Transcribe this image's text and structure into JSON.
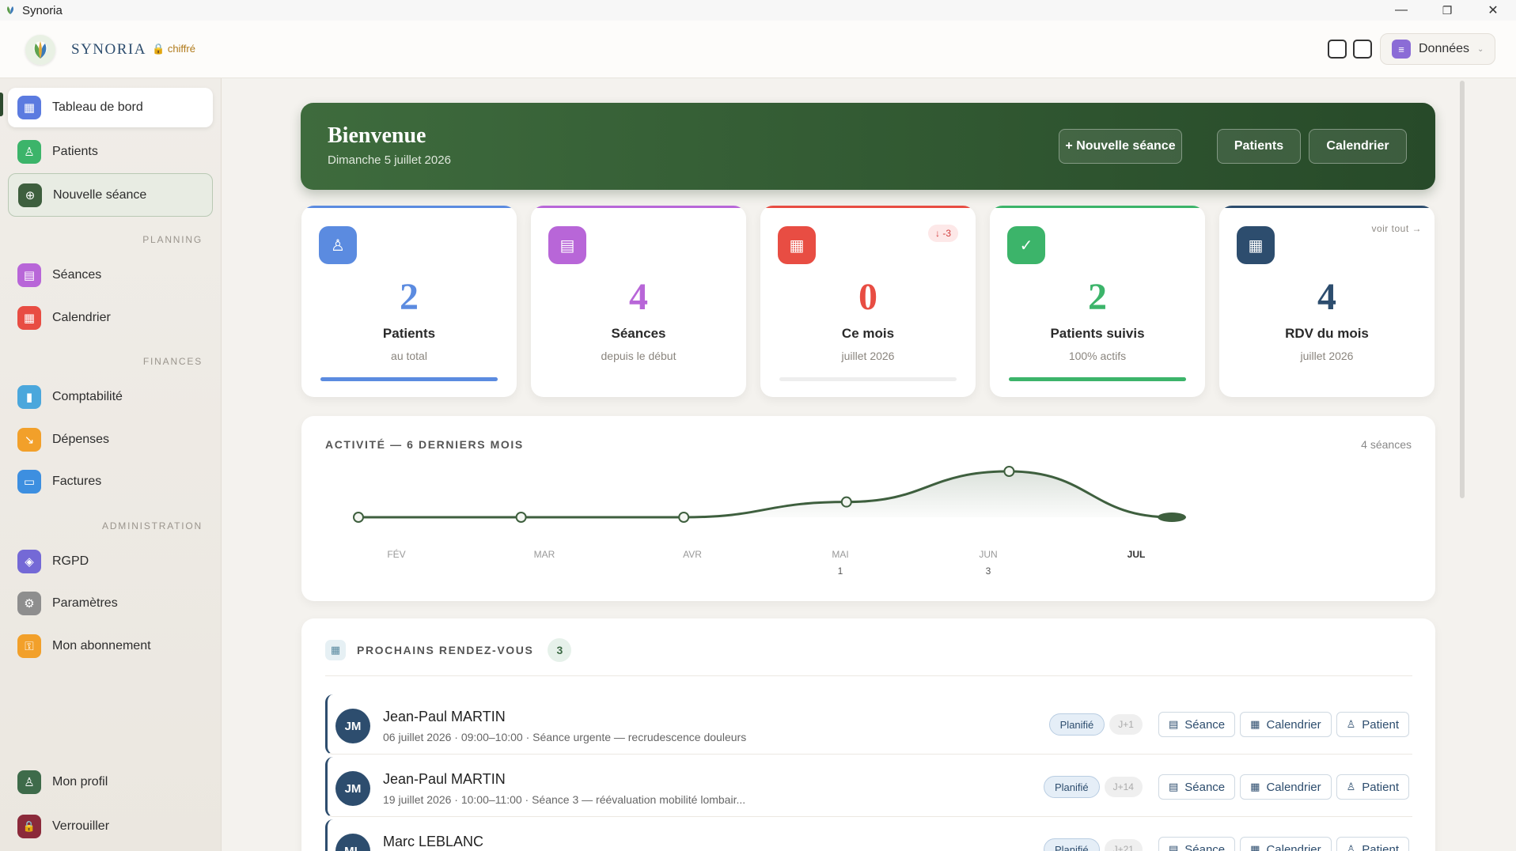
{
  "window": {
    "title": "Synoria",
    "controls": [
      "—",
      "❐",
      "✕"
    ]
  },
  "header": {
    "brand": "SYNORIA",
    "lock_badge": "chiffré",
    "data_button": "Données",
    "caret": "⌄"
  },
  "sidebar": {
    "top_items": [
      {
        "label": "Tableau de bord",
        "icon": "grid-icon",
        "glyph": "▦",
        "color": "#5b7be0"
      },
      {
        "label": "Patients",
        "icon": "user-icon",
        "glyph": "♙",
        "color": "#3cb46a"
      },
      {
        "label": "Nouvelle séance",
        "icon": "plus-circle-icon",
        "glyph": "⊕",
        "color": "#3e5f3e"
      }
    ],
    "sections": [
      {
        "title": "PLANNING",
        "items": [
          {
            "label": "Séances",
            "icon": "clipboard-icon",
            "glyph": "▤",
            "color": "#b866d8"
          },
          {
            "label": "Calendrier",
            "icon": "calendar-icon",
            "glyph": "▦",
            "color": "#e84d43"
          }
        ]
      },
      {
        "title": "FINANCES",
        "items": [
          {
            "label": "Comptabilité",
            "icon": "bar-chart-icon",
            "glyph": "▮",
            "color": "#4ba7dc"
          },
          {
            "label": "Dépenses",
            "icon": "trend-down-icon",
            "glyph": "↘",
            "color": "#f2a02a"
          },
          {
            "label": "Factures",
            "icon": "file-icon",
            "glyph": "▭",
            "color": "#3d8fe0"
          }
        ]
      },
      {
        "title": "ADMINISTRATION",
        "items": [
          {
            "label": "RGPD",
            "icon": "shield-icon",
            "glyph": "◈",
            "color": "#7469d6"
          },
          {
            "label": "Paramètres",
            "icon": "gear-icon",
            "glyph": "⚙",
            "color": "#8e8e8e"
          },
          {
            "label": "Mon abonnement",
            "icon": "key-icon",
            "glyph": "⚿",
            "color": "#f2a02a"
          }
        ]
      }
    ],
    "bottom_items": [
      {
        "label": "Mon profil",
        "icon": "user-icon",
        "glyph": "♙",
        "color": "#3e6b4a"
      },
      {
        "label": "Verrouiller",
        "icon": "lock-icon",
        "glyph": "🔒",
        "color": "#8b2a3a"
      }
    ]
  },
  "banner": {
    "title": "Bienvenue",
    "date": "Dimanche 5 juillet 2026",
    "buttons": [
      "+ Nouvelle séance",
      "Patients",
      "Calendrier"
    ]
  },
  "stats": [
    {
      "value": "2",
      "label": "Patients",
      "sub": "au total",
      "color": "#5b8be0",
      "icon": "user-icon",
      "progress": 1.0
    },
    {
      "value": "4",
      "label": "Séances",
      "sub": "depuis le début",
      "color": "#b866d8",
      "icon": "clipboard-icon",
      "progress": null
    },
    {
      "value": "0",
      "label": "Ce mois",
      "sub": "juillet 2026",
      "color": "#e84d43",
      "icon": "calendar-icon",
      "progress": 0.0,
      "trend": "↓ -3"
    },
    {
      "value": "2",
      "label": "Patients suivis",
      "sub": "100% actifs",
      "color": "#3cb46a",
      "icon": "check-icon",
      "progress": 1.0
    },
    {
      "value": "4",
      "label": "RDV du mois",
      "sub": "juillet 2026",
      "color": "#2d4d6e",
      "icon": "calendar-grid-icon",
      "progress": null,
      "link": "voir tout →"
    }
  ],
  "activity": {
    "title": "ACTIVITÉ — 6 DERNIERS MOIS",
    "count": "4 séances",
    "chart_data": {
      "type": "area",
      "categories": [
        "FÉV",
        "MAR",
        "AVR",
        "MAI",
        "JUN",
        "JUL"
      ],
      "values": [
        0,
        0,
        0,
        1,
        3,
        0
      ],
      "value_labels": [
        "",
        "",
        "",
        "1",
        "3",
        ""
      ],
      "line_color": "#3e5f3e",
      "highlight_last": true
    }
  },
  "rdv": {
    "title": "PROCHAINS RENDEZ-VOUS",
    "count": "3",
    "status_label": "Planifié",
    "buttons": {
      "seance": "Séance",
      "calendrier": "Calendrier",
      "patient": "Patient"
    },
    "items": [
      {
        "initials": "JM",
        "name": "Jean-Paul MARTIN",
        "details": "06 juillet 2026 · 09:00–10:00 · Séance urgente — recrudescence douleurs",
        "days": "J+1"
      },
      {
        "initials": "JM",
        "name": "Jean-Paul MARTIN",
        "details": "19 juillet 2026 · 10:00–11:00 · Séance 3 — réévaluation mobilité lombair...",
        "days": "J+14"
      },
      {
        "initials": "ML",
        "name": "Marc LEBLANC",
        "details": "",
        "days": "J+21"
      }
    ]
  }
}
